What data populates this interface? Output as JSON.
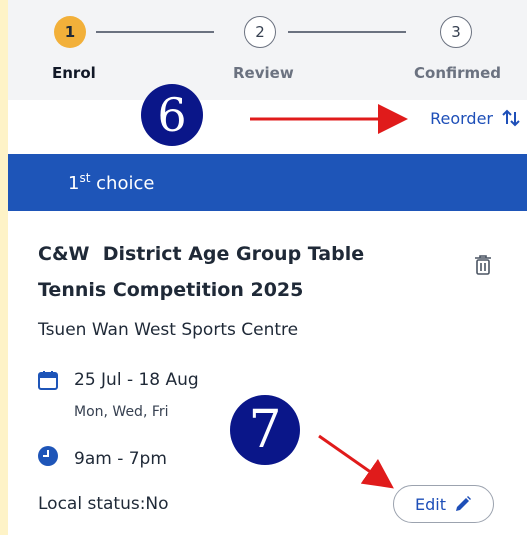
{
  "stepper": {
    "steps": [
      {
        "number": "1",
        "label": "Enrol",
        "state": "active"
      },
      {
        "number": "2",
        "label": "Review",
        "state": "todo"
      },
      {
        "number": "3",
        "label": "Confirmed",
        "state": "todo"
      }
    ]
  },
  "reorder": {
    "label": "Reorder",
    "icon": "sort-arrows-icon"
  },
  "annotations": {
    "marker_6": "6",
    "marker_7": "7",
    "arrow_color": "#e01b1b",
    "marker_color": "#0a1689"
  },
  "card": {
    "header_prefix": "1",
    "header_sup": "st",
    "header_suffix": " choice",
    "title_line1": "C&W  District Age Group Table",
    "title_line2": "Tennis Competition 2025",
    "venue": "Tsuen Wan West Sports Centre",
    "dates": "25 Jul - 18 Aug",
    "days": "Mon, Wed, Fri",
    "time": "9am - 7pm",
    "local_status": "Local status:No",
    "edit_label": "Edit",
    "accent": "#1e55b8"
  }
}
